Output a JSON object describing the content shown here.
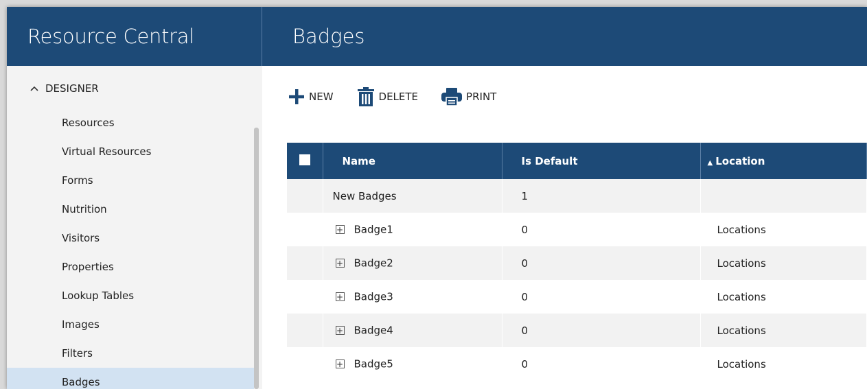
{
  "app": {
    "title": "Resource Central"
  },
  "page": {
    "title": "Badges"
  },
  "sidebar": {
    "section": {
      "label": "DESIGNER"
    },
    "items": [
      {
        "label": "Resources"
      },
      {
        "label": "Virtual Resources"
      },
      {
        "label": "Forms"
      },
      {
        "label": "Nutrition"
      },
      {
        "label": "Visitors"
      },
      {
        "label": "Properties"
      },
      {
        "label": "Lookup Tables"
      },
      {
        "label": "Images"
      },
      {
        "label": "Filters"
      },
      {
        "label": "Badges",
        "active": true
      }
    ]
  },
  "toolbar": {
    "new_label": "NEW",
    "delete_label": "DELETE",
    "print_label": "PRINT"
  },
  "table": {
    "headers": {
      "name": "Name",
      "is_default": "Is Default",
      "location": "Location"
    },
    "sort_indicator": "▲",
    "rows": [
      {
        "name": "New Badges",
        "is_default": "1",
        "location": ""
      },
      {
        "name": "Badge1",
        "is_default": "0",
        "location": "Locations"
      },
      {
        "name": "Badge2",
        "is_default": "0",
        "location": "Locations"
      },
      {
        "name": "Badge3",
        "is_default": "0",
        "location": "Locations"
      },
      {
        "name": "Badge4",
        "is_default": "0",
        "location": "Locations"
      },
      {
        "name": "Badge5",
        "is_default": "0",
        "location": "Locations"
      }
    ]
  },
  "colors": {
    "header_bg": "#1d4a77",
    "sidebar_bg": "#f3f3f3",
    "active_item_bg": "#d2e2f2",
    "alt_row_bg": "#f2f2f2"
  },
  "icons": {
    "new": "plus-icon",
    "delete": "trash-icon",
    "print": "printer-icon",
    "section_toggle": "chevron-up-icon",
    "row_expand": "plus-box-icon"
  }
}
